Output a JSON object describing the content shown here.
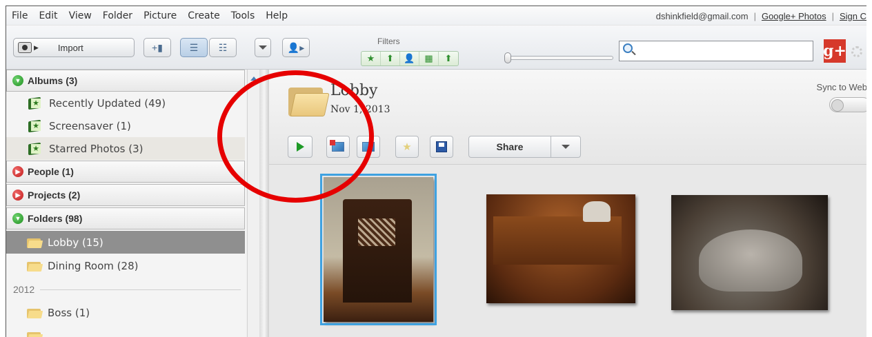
{
  "menubar": {
    "items": [
      "File",
      "Edit",
      "View",
      "Folder",
      "Picture",
      "Create",
      "Tools",
      "Help"
    ],
    "account_email": "dshinkfield@gmail.com",
    "separator": "|",
    "google_photos_link": "Google+ Photos",
    "sign_link": "Sign C"
  },
  "toolbar": {
    "import_label": "Import",
    "filters_label": "Filters",
    "filter_icons": [
      "star-icon",
      "upload-icon",
      "person-icon",
      "movie-icon",
      "geotag-icon"
    ],
    "filter_glyphs": [
      "★",
      "⬆",
      "👤",
      "▦",
      "⬆"
    ],
    "search_value": "",
    "gplus_label": "g+"
  },
  "sidebar": {
    "albums": {
      "label": "Albums (3)",
      "items": [
        "Recently Updated (49)",
        "Screensaver (1)",
        "Starred Photos (3)"
      ]
    },
    "people": {
      "label": "People (1)"
    },
    "projects": {
      "label": "Projects (2)"
    },
    "folders": {
      "label": "Folders (98)",
      "items": [
        "Lobby (15)",
        "Dining Room (28)"
      ],
      "year": "2012",
      "year_items": [
        "Boss (1)"
      ]
    }
  },
  "main": {
    "folder_name": "Lobby",
    "folder_date": "Nov 1, 2013",
    "sync_label": "Sync to Web",
    "share_label": "Share"
  },
  "photos": [
    {
      "name": "gothic-chair-photo",
      "selected": true
    },
    {
      "name": "wooden-chest-photo",
      "selected": false
    },
    {
      "name": "stone-sculpture-photo",
      "selected": false
    }
  ],
  "colors": {
    "annotation_circle": "#e60000",
    "selection": "#3fa2e1",
    "gplus": "#d6392b",
    "selected_folder": "#8f8f8f"
  }
}
